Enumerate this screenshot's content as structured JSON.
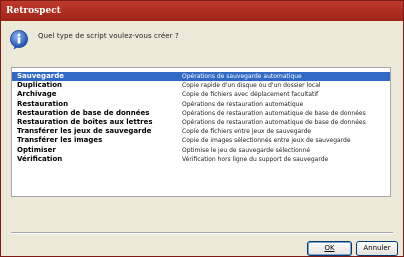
{
  "window": {
    "title": "Retrospect"
  },
  "dialog": {
    "prompt": "Quel type de script voulez-vous créer ?",
    "icon": "info-icon",
    "accent": "#316ac5"
  },
  "scripts": [
    {
      "name": "Sauvegarde",
      "desc": "Opérations de sauvegarde automatique",
      "selected": true
    },
    {
      "name": "Duplication",
      "desc": "Copie rapide d'un disque ou d'un dossier local",
      "selected": false
    },
    {
      "name": "Archivage",
      "desc": "Copie de fichiers avec déplacement facultatif",
      "selected": false
    },
    {
      "name": "Restauration",
      "desc": "Opérations de restauration automatique",
      "selected": false
    },
    {
      "name": "Restauration de base de données",
      "desc": "Opérations de restauration automatique de base de données",
      "selected": false
    },
    {
      "name": "Restauration de boîtes aux lettres",
      "desc": "Opérations de restauration automatique de base de données",
      "selected": false
    },
    {
      "name": "Transférer les jeux de sauvegarde",
      "desc": "Copie de fichiers entre jeux de sauvegarde",
      "selected": false
    },
    {
      "name": "Transférer les images",
      "desc": "Copie de images sélectionnés entre jeux de sauvegarde",
      "selected": false
    },
    {
      "name": "Optimiser",
      "desc": "Optimise le jeu de sauvegarde sélectionné",
      "selected": false
    },
    {
      "name": "Vérification",
      "desc": "Vérification hors ligne du support de sauvegarde",
      "selected": false
    }
  ],
  "buttons": {
    "ok": "OK",
    "cancel": "Annuler"
  }
}
